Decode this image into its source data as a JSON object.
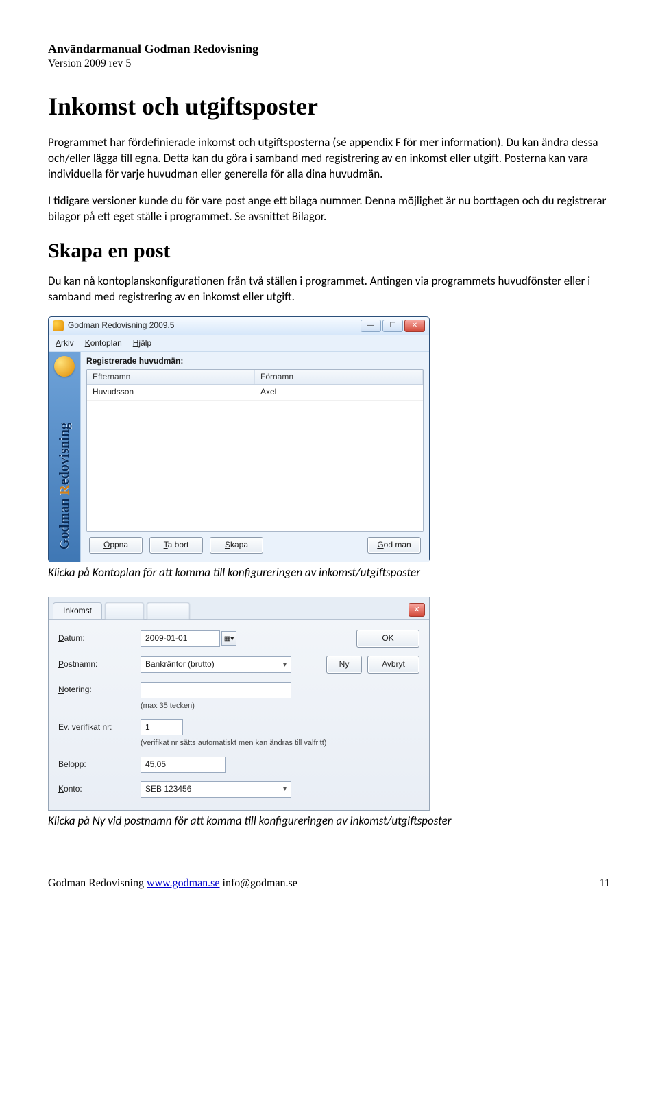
{
  "header": {
    "title": "Användarmanual Godman Redovisning",
    "version": "Version 2009 rev 5"
  },
  "h1": "Inkomst och utgiftsposter",
  "para1": "Programmet har fördefinierade inkomst och utgiftsposterna (se appendix F för mer information). Du kan ändra dessa och/eller lägga till egna. Detta kan du göra i samband med registrering av en inkomst eller utgift. Posterna kan vara individuella för varje huvudman eller generella för alla dina huvudmän.",
  "para2": "I tidigare versioner kunde du för vare post ange ett bilaga nummer. Denna möjlighet är nu borttagen och du registrerar bilagor på ett eget ställe i programmet. Se avsnittet Bilagor.",
  "h2": "Skapa en post",
  "para3": "Du kan nå kontoplanskonfigurationen från två ställen i programmet. Antingen via programmets huvudfönster eller i samband med registrering av en inkomst eller utgift.",
  "caption1": "Klicka på Kontoplan för att komma till konfigureringen av inkomst/utgiftsposter",
  "caption2": "Klicka på Ny vid postnamn för att komma till konfigureringen av inkomst/utgiftsposter",
  "win1": {
    "title": "Godman Redovisning 2009.5",
    "menu": {
      "arkiv": "Arkiv",
      "kontoplan": "Kontoplan",
      "hjalp": "Hjälp"
    },
    "section": "Registrerade huvudmän:",
    "sidebar_a": "Godman ",
    "sidebar_b": "Redovisning",
    "columns": {
      "efternamn": "Efternamn",
      "fornamn": "Förnamn"
    },
    "row": {
      "efternamn": "Huvudsson",
      "fornamn": "Axel"
    },
    "buttons": {
      "oppna": "Öppna",
      "tabort": "Ta bort",
      "skapa": "Skapa",
      "godman": "God man"
    }
  },
  "win2": {
    "tab_active": "Inkomst",
    "labels": {
      "datum": "Datum:",
      "postnamn": "Postnamn:",
      "notering": "Notering:",
      "verifikat": "Ev. verifikat nr:",
      "belopp": "Belopp:",
      "konto": "Konto:"
    },
    "values": {
      "datum": "2009-01-01",
      "postnamn": "Bankräntor (brutto)",
      "notering": "",
      "verifikat": "1",
      "belopp": "45,05",
      "konto": "SEB 123456"
    },
    "hints": {
      "notering": "(max 35 tecken)",
      "verifikat": "(verifikat nr sätts automatiskt men kan ändras till valfritt)"
    },
    "buttons": {
      "ok": "OK",
      "ny": "Ny",
      "avbryt": "Avbryt"
    }
  },
  "footer": {
    "left_a": "Godman Redovisning ",
    "url": "www.godman.se",
    "email": " info@godman.se",
    "page": "11"
  }
}
